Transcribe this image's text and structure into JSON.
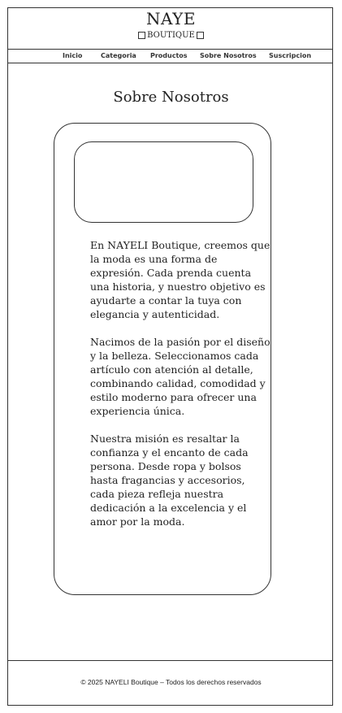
{
  "brand": {
    "title": "NAYE",
    "subtitle": "BOUTIQUE"
  },
  "nav": {
    "items": [
      {
        "label": "Inicio"
      },
      {
        "label": "Categoria"
      },
      {
        "label": "Productos"
      },
      {
        "label": "Sobre Nosotros"
      },
      {
        "label": "Suscripcion"
      }
    ]
  },
  "main": {
    "title": "Sobre Nosotros",
    "paragraphs": [
      "En NAYELI Boutique, creemos que la moda es una forma de expresión. Cada prenda cuenta una historia, y nuestro objetivo es ayudarte a contar la tuya con elegancia y autenticidad.",
      "Nacimos de la pasión por el diseño y la belleza. Seleccionamos cada artículo con atención al detalle, combinando calidad, comodidad y estilo moderno para ofrecer una experiencia única.",
      "Nuestra misión es resaltar la confianza y el encanto de cada persona. Desde ropa y bolsos hasta fragancias y accesorios, cada pieza refleja nuestra dedicación a la excelencia y el amor por la moda."
    ]
  },
  "footer": {
    "text": "© 2025 NAYELI Boutique – Todos los derechos reservados"
  },
  "colors": {
    "line": "#333333",
    "background": "#ffffff"
  }
}
